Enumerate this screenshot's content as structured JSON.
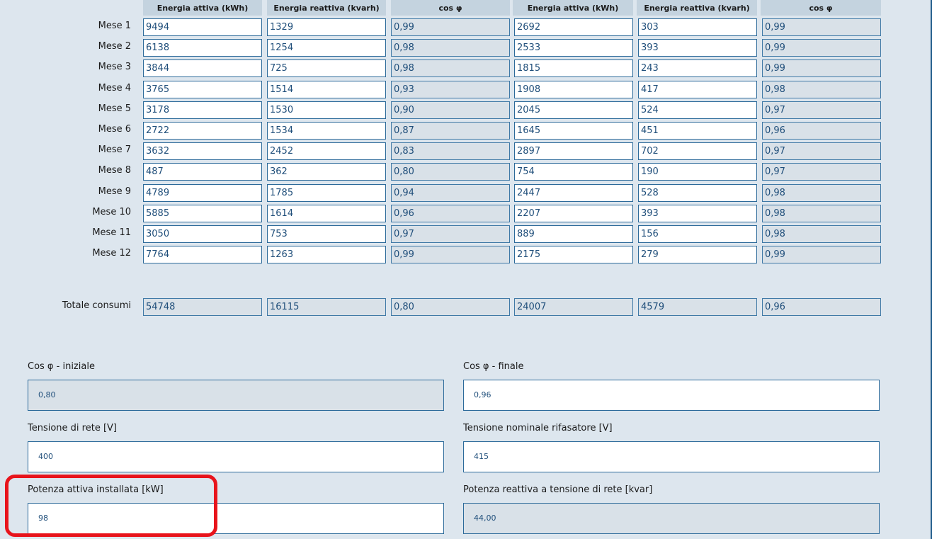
{
  "table": {
    "headers": [
      "Energia attiva (kWh)",
      "Energia reattiva (kvarh)",
      "cos φ",
      "Energia attiva (kWh)",
      "Energia reattiva (kvarh)",
      "cos φ"
    ],
    "rows": [
      {
        "label": "Mese 1",
        "values": [
          "9494",
          "1329",
          "0,99",
          "2692",
          "303",
          "0,99"
        ]
      },
      {
        "label": "Mese 2",
        "values": [
          "6138",
          "1254",
          "0,98",
          "2533",
          "393",
          "0,99"
        ]
      },
      {
        "label": "Mese 3",
        "values": [
          "3844",
          "725",
          "0,98",
          "1815",
          "243",
          "0,99"
        ]
      },
      {
        "label": "Mese 4",
        "values": [
          "3765",
          "1514",
          "0,93",
          "1908",
          "417",
          "0,98"
        ]
      },
      {
        "label": "Mese 5",
        "values": [
          "3178",
          "1530",
          "0,90",
          "2045",
          "524",
          "0,97"
        ]
      },
      {
        "label": "Mese 6",
        "values": [
          "2722",
          "1534",
          "0,87",
          "1645",
          "451",
          "0,96"
        ]
      },
      {
        "label": "Mese 7",
        "values": [
          "3632",
          "2452",
          "0,83",
          "2897",
          "702",
          "0,97"
        ]
      },
      {
        "label": "Mese 8",
        "values": [
          "487",
          "362",
          "0,80",
          "754",
          "190",
          "0,97"
        ]
      },
      {
        "label": "Mese 9",
        "values": [
          "4789",
          "1785",
          "0,94",
          "2447",
          "528",
          "0,98"
        ]
      },
      {
        "label": "Mese 10",
        "values": [
          "5885",
          "1614",
          "0,96",
          "2207",
          "393",
          "0,98"
        ]
      },
      {
        "label": "Mese 11",
        "values": [
          "3050",
          "753",
          "0,97",
          "889",
          "156",
          "0,98"
        ]
      },
      {
        "label": "Mese 12",
        "values": [
          "7764",
          "1263",
          "0,99",
          "2175",
          "279",
          "0,99"
        ]
      }
    ],
    "totals": {
      "label": "Totale consumi",
      "values": [
        "54748",
        "16115",
        "0,80",
        "24007",
        "4579",
        "0,96"
      ]
    }
  },
  "fields": {
    "cos_iniziale": {
      "label": "Cos φ - iniziale",
      "value": "0,80"
    },
    "cos_finale": {
      "label": "Cos φ - finale",
      "value": "0,96"
    },
    "tensione_rete": {
      "label": "Tensione di rete [V]",
      "value": "400"
    },
    "tensione_rifasatore": {
      "label": "Tensione nominale rifasatore [V]",
      "value": "415"
    },
    "potenza_attiva": {
      "label": "Potenza attiva installata [kW]",
      "value": "98"
    },
    "potenza_reattiva": {
      "label": "Potenza reattiva a tensione di rete [kvar]",
      "value": "44,00"
    }
  },
  "colors": {
    "accent": "#1e5a8a",
    "highlight": "#e8141c",
    "readonly_bg": "#d9e1e8"
  }
}
